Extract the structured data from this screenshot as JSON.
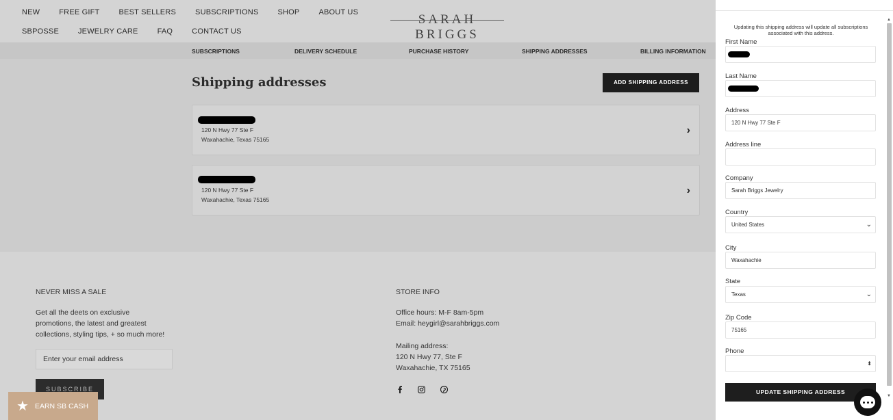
{
  "nav": {
    "items": [
      "NEW",
      "FREE GIFT",
      "BEST SELLERS",
      "SUBSCRIPTIONS",
      "SHOP",
      "ABOUT US",
      "SBPOSSE",
      "JEWELRY CARE",
      "FAQ",
      "CONTACT US"
    ],
    "logo": "SARAH BRIGGS"
  },
  "account_tabs": [
    "SUBSCRIPTIONS",
    "DELIVERY SCHEDULE",
    "PURCHASE HISTORY",
    "SHIPPING ADDRESSES",
    "BILLING INFORMATION"
  ],
  "main": {
    "title": "Shipping addresses",
    "add_button": "ADD SHIPPING ADDRESS",
    "addresses": [
      {
        "line1": "120 N Hwy 77 Ste F",
        "line2": "Waxahachie, Texas 75165"
      },
      {
        "line1": "120 N Hwy 77 Ste F",
        "line2": "Waxahachie, Texas 75165"
      }
    ]
  },
  "footer": {
    "newsletter_heading": "NEVER MISS A SALE",
    "newsletter_text": [
      "Get all the deets on exclusive",
      "promotions, the latest and greatest",
      "collections, styling tips, + so much more!"
    ],
    "email_placeholder": "Enter your email address",
    "subscribe_label": "SUBSCRIBE",
    "store_heading": "STORE INFO",
    "office_hours": "Office hours: M-F 8am-5pm",
    "email": "Email: heygirl@sarahbriggs.com",
    "mailing_label": "Mailing address:",
    "mailing_line1": "120 N Hwy 77, Ste F",
    "mailing_line2": "Waxahachie, TX 75165",
    "social_icons": [
      "facebook-icon",
      "instagram-icon",
      "pinterest-icon"
    ]
  },
  "earn_button": "EARN SB CASH",
  "panel": {
    "note": "Updating this shipping address will update all subscriptions associated with this address.",
    "first_name_label": "First Name",
    "last_name_label": "Last Name",
    "address_label": "Address",
    "address_value": "120 N Hwy 77 Ste F",
    "address_line_label": "Address line",
    "address_line_value": "",
    "company_label": "Company",
    "company_value": "Sarah Briggs Jewelry",
    "country_label": "Country",
    "country_value": "United States",
    "city_label": "City",
    "city_value": "Waxahachie",
    "state_label": "State",
    "state_value": "Texas",
    "zip_label": "Zip Code",
    "zip_value": "75165",
    "phone_label": "Phone",
    "phone_value": "",
    "update_button": "UPDATE SHIPPING ADDRESS"
  }
}
